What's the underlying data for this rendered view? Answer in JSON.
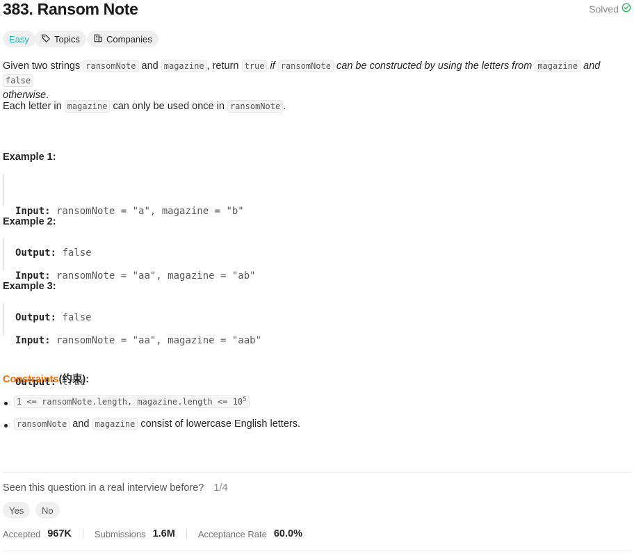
{
  "problem": {
    "title": "383. Ransom Note",
    "status": "Solved"
  },
  "tags": {
    "difficulty": "Easy",
    "topics": "Topics",
    "companies": "Companies"
  },
  "description": {
    "p1_a": "Given two strings ",
    "p1_code1": "ransomNote",
    "p1_b": " and ",
    "p1_code2": "magazine",
    "p1_c": ", return ",
    "p1_code3": "true",
    "p1_d": " if ",
    "p1_code4": "ransomNote",
    "p1_e": " can be constructed by using the letters from ",
    "p1_code5": "magazine",
    "p1_f": " and ",
    "p1_code6": "false",
    "p1_g": "otherwise",
    "p1_h": ".",
    "p2_a": "Each letter in ",
    "p2_code1": "magazine",
    "p2_b": " can only be used once in ",
    "p2_code2": "ransomNote",
    "p2_c": "."
  },
  "examples": [
    {
      "heading": "Example 1:",
      "input_label": "Input:",
      "input": " ransomNote = \"a\", magazine = \"b\"",
      "output_label": "Output:",
      "output": " false"
    },
    {
      "heading": "Example 2:",
      "input_label": "Input:",
      "input": " ransomNote = \"aa\", magazine = \"ab\"",
      "output_label": "Output:",
      "output": " false"
    },
    {
      "heading": "Example 3:",
      "input_label": "Input:",
      "input": " ransomNote = \"aa\", magazine = \"aab\"",
      "output_label": "Output:",
      "output": " true"
    }
  ],
  "constraints": {
    "title": "Constraints",
    "title_suffix": "(约束):",
    "c1_code": "1 <= ransomNote.length, magazine.length <= 10",
    "c1_sup": "5",
    "c2_code1": "ransomNote",
    "c2_a": " and ",
    "c2_code2": "magazine",
    "c2_b": " consist of lowercase English letters."
  },
  "interview": {
    "question": "Seen this question in a real interview before?",
    "count": "1/4",
    "yes": "Yes",
    "no": "No"
  },
  "stats": {
    "accepted_label": "Accepted",
    "accepted_value": "967K",
    "submissions_label": "Submissions",
    "submissions_value": "1.6M",
    "acceptance_label": "Acceptance Rate",
    "acceptance_value": "60.0%"
  },
  "colors": {
    "easy": "#1cb8b8",
    "solved_check": "#2db55d",
    "constraints": "#f56a00"
  }
}
